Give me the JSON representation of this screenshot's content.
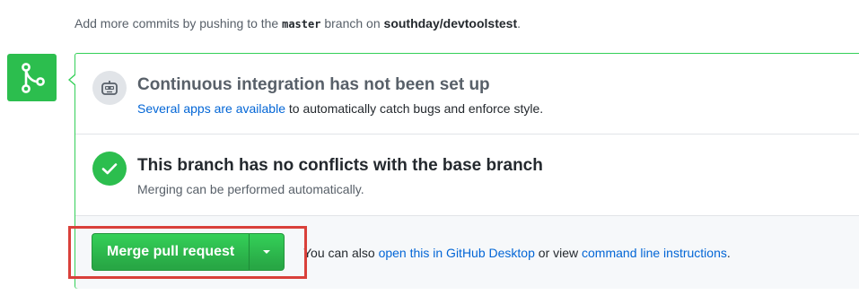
{
  "hint": {
    "prefix": "Add more commits by pushing to the ",
    "branch": "master",
    "middle": " branch on ",
    "repo": "southday/devtoolstest",
    "suffix": "."
  },
  "ci": {
    "title": "Continuous integration has not been set up",
    "link": "Several apps are available",
    "desc_rest": " to automatically catch bugs and enforce style.",
    "icon": "robot-icon"
  },
  "conflicts": {
    "title": "This branch has no conflicts with the base branch",
    "desc": "Merging can be performed automatically.",
    "icon": "check-icon"
  },
  "merge": {
    "button_label": "Merge pull request",
    "dropdown_icon": "triangle-down-icon",
    "text_prefix": "You can also ",
    "desktop_link": "open this in GitHub Desktop",
    "text_middle": " or view ",
    "cli_link": "command line instructions",
    "text_suffix": "."
  },
  "colors": {
    "success_green": "#2cbe4e",
    "link_blue": "#0366d6",
    "highlight_red": "#d9403a",
    "panel_border": "#34d058"
  },
  "timeline_icon": "git-merge-icon"
}
